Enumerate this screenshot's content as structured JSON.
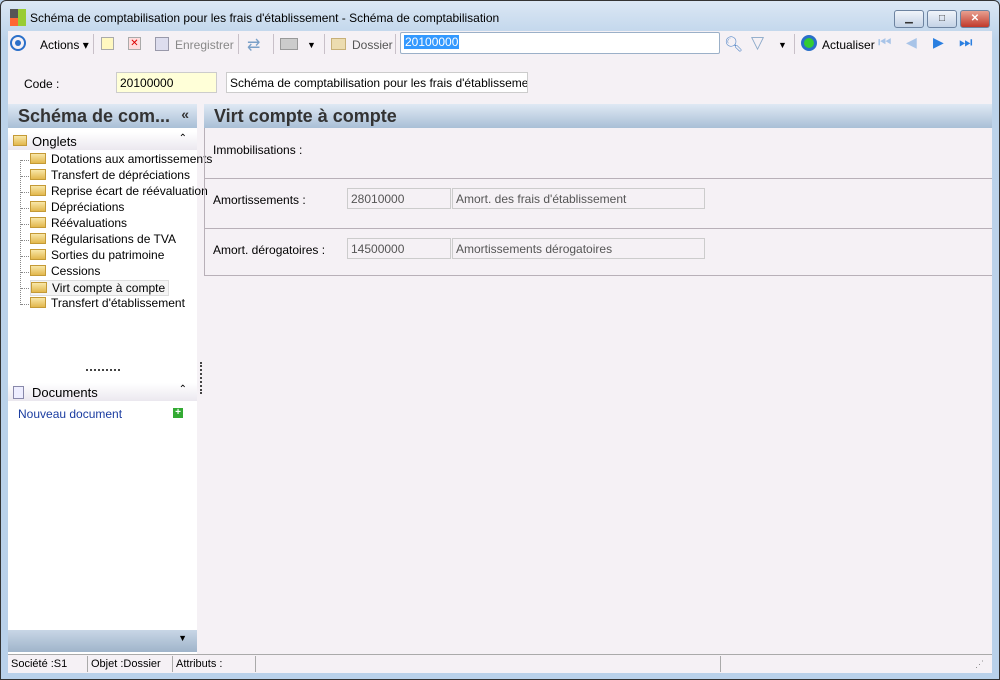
{
  "window": {
    "title": "Schéma de comptabilisation pour les frais d'établissement -  Schéma de comptabilisation"
  },
  "toolbar": {
    "actions": "Actions",
    "save": "Enregistrer",
    "dossier": "Dossier",
    "search_value": "20100000",
    "refresh": "Actualiser"
  },
  "header": {
    "code_label": "Code :",
    "code_value": "20100000",
    "description": "Schéma de comptabilisation pour les frais d'établissement"
  },
  "left_panel": {
    "title": "Schéma de com...",
    "tabs_group": "Onglets",
    "items": [
      "Dotations aux amortissements",
      "Transfert de dépréciations",
      "Reprise écart de réévaluation",
      "Dépréciations",
      "Réévaluations",
      "Régularisations de TVA",
      "Sorties du patrimoine",
      "Cessions",
      "Virt compte à compte",
      "Transfert d'établissement"
    ],
    "selected": "Virt compte à compte",
    "documents_group": "Documents",
    "new_document": "Nouveau document"
  },
  "main": {
    "title": "Virt compte à compte",
    "immobilisations_label": "Immobilisations :",
    "amortissements_label": "Amortissements :",
    "amortissements_code": "28010000",
    "amortissements_desc": "Amort. des frais d'établissement",
    "derogatoires_label": "Amort. dérogatoires :",
    "derogatoires_code": "14500000",
    "derogatoires_desc": "Amortissements dérogatoires"
  },
  "status": {
    "societe": "Société :S1",
    "objet": "Objet :Dossier",
    "attributs": "Attributs :"
  }
}
